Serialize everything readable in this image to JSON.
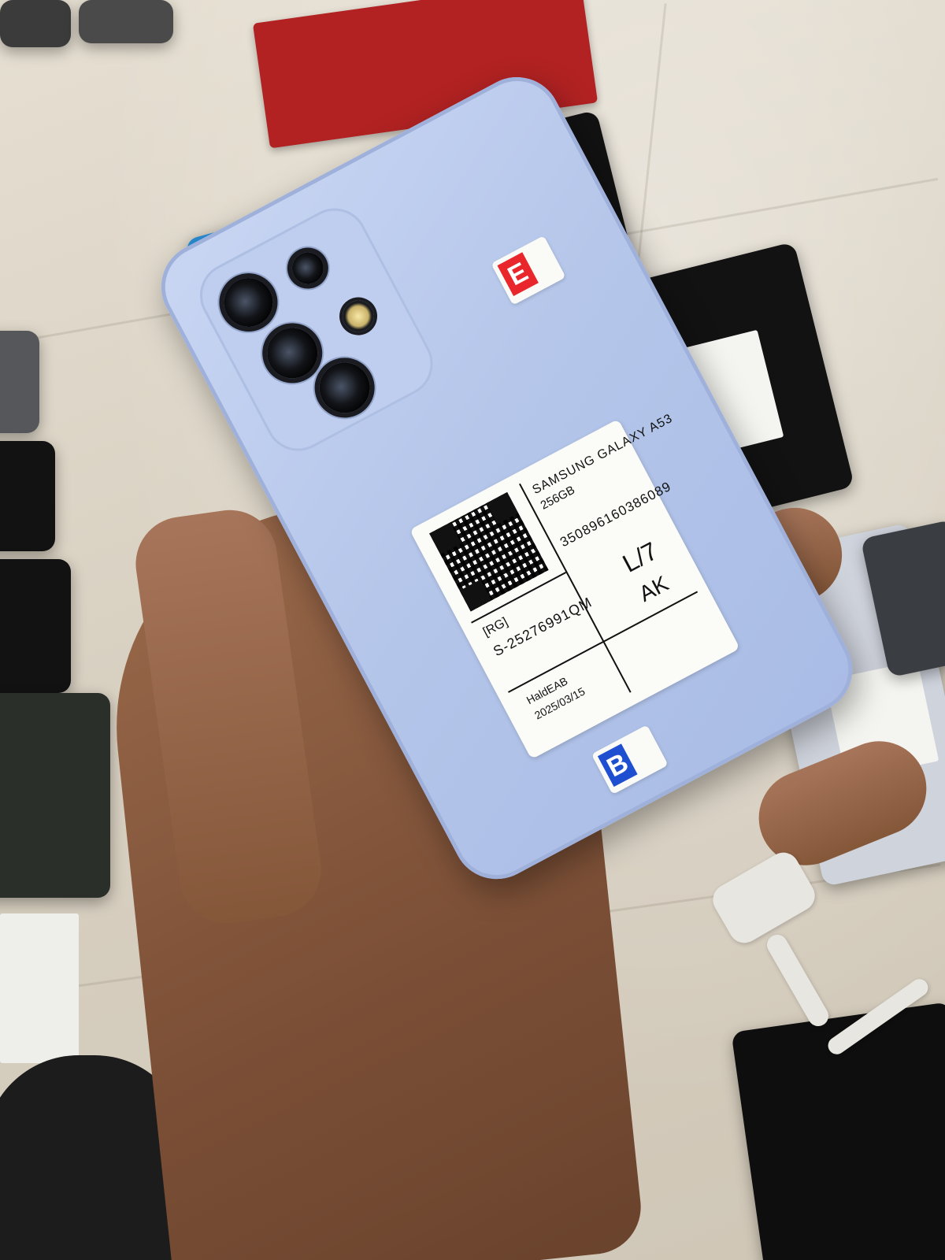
{
  "label": {
    "model": "SAMSUNG GALAXY A53",
    "storage": "256GB",
    "imei": "350896160386089",
    "code": "S-25276991QM",
    "tag": "[RG]",
    "grade": "L/7",
    "initials": "AK",
    "stamp": "HaldEAB",
    "date": "2025/03/15"
  },
  "stickers": {
    "top_letter": "E",
    "bottom_letter": "B"
  },
  "colors": {
    "phone_body": "#b5c6ea",
    "sticker_red": "#e8262b",
    "sticker_blue": "#1f4fd1"
  }
}
